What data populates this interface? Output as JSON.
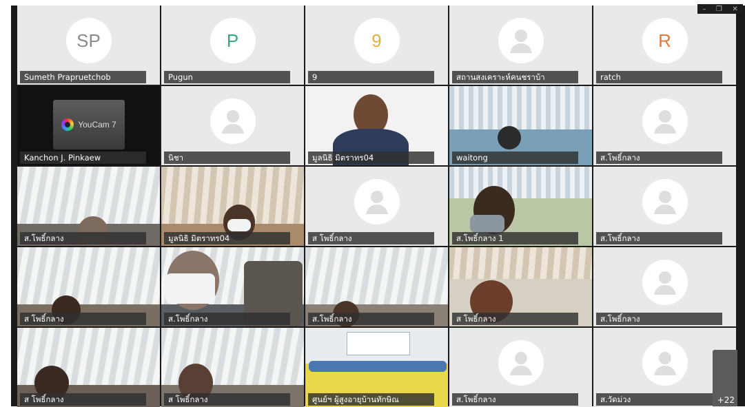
{
  "window_controls": {
    "minimize": "–",
    "restore": "❐",
    "close": "✕"
  },
  "overflow_count": "+22",
  "colors": {
    "avatar_sp": "#8a8a8a",
    "avatar_p": "#3aa87a",
    "avatar_9": "#e0b13a",
    "avatar_r": "#e07a3a"
  },
  "tiles": [
    {
      "name": "Sumeth Prapruetchob",
      "initials": "SP"
    },
    {
      "name": "Pugun",
      "initials": "P"
    },
    {
      "name": "9",
      "initials": "9"
    },
    {
      "name": "สถานสงเคราะห์คนชราบ้า",
      "icon": "person-icon"
    },
    {
      "name": "ratch",
      "initials": "R"
    },
    {
      "name": "Kanchon J. Pinkaew",
      "brand": "YouCam 7"
    },
    {
      "name": "นิชา",
      "icon": "person-icon"
    },
    {
      "name": "มูลนิธิ มิตราทร04"
    },
    {
      "name": "waitong"
    },
    {
      "name": "ส.โพธิ์กลาง",
      "icon": "person-icon"
    },
    {
      "name": "ส.โพธิ์กลาง"
    },
    {
      "name": "มูลนิธิ มิตราทร04"
    },
    {
      "name": "ส โพธิ์กลาง",
      "icon": "person-icon"
    },
    {
      "name": "ส.โพธิ์กลาง 1"
    },
    {
      "name": "ส.โพธิ์กลาง",
      "icon": "person-icon"
    },
    {
      "name": "ส โพธิ์กลาง"
    },
    {
      "name": "ส.โพธิ์กลาง"
    },
    {
      "name": "ส.โพธิ์กลาง"
    },
    {
      "name": "ส โพธิ์กลาง"
    },
    {
      "name": "ส.โพธิ์กลาง",
      "icon": "person-icon"
    },
    {
      "name": "ส โพธิ์กลาง"
    },
    {
      "name": "ส โพธิ์กลาง"
    },
    {
      "name": "ศูนย์ฯ ผู้สูงอายุบ้านทักษิณ"
    },
    {
      "name": "ส.โพธิ์กลาง",
      "icon": "person-icon"
    },
    {
      "name": "ส.วัดม่วง",
      "icon": "person-icon"
    }
  ]
}
